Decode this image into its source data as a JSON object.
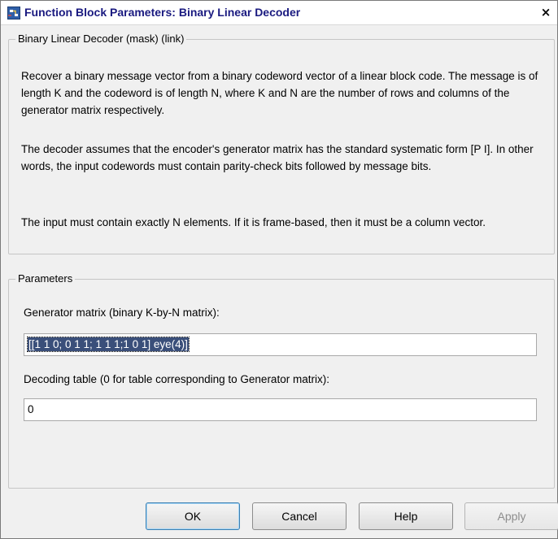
{
  "window": {
    "title": "Function Block Parameters: Binary Linear Decoder",
    "close_glyph": "×"
  },
  "description_group": {
    "legend": "Binary Linear Decoder (mask) (link)",
    "paragraphs": [
      "Recover a binary message vector from a binary codeword vector of a linear block code.  The message is of length K and the codeword is of length N, where K and N are the number of rows and columns of the generator matrix respectively.",
      "The decoder assumes that the encoder's generator matrix has the standard systematic form [P I].  In other words, the input codewords must contain parity-check bits followed by message bits.",
      "The input must contain exactly N elements.  If it is frame-based, then it must be a column vector."
    ]
  },
  "parameters_group": {
    "legend": "Parameters",
    "generator_matrix": {
      "label": "Generator matrix (binary K-by-N matrix):",
      "value": "[[1 1 0; 0 1 1; 1 1 1;1 0 1] eye(4)]"
    },
    "decoding_table": {
      "label": "Decoding table (0 for table corresponding to Generator matrix):",
      "value": "0"
    }
  },
  "buttons": {
    "ok": "OK",
    "cancel": "Cancel",
    "help": "Help",
    "apply": "Apply"
  },
  "icons": {
    "title_icon": "simulink-block-icon",
    "close_icon": "close-icon"
  },
  "colors": {
    "title_text": "#1a1a80",
    "selection": "#3a4f7a",
    "window_bg": "#f0f0f0"
  }
}
